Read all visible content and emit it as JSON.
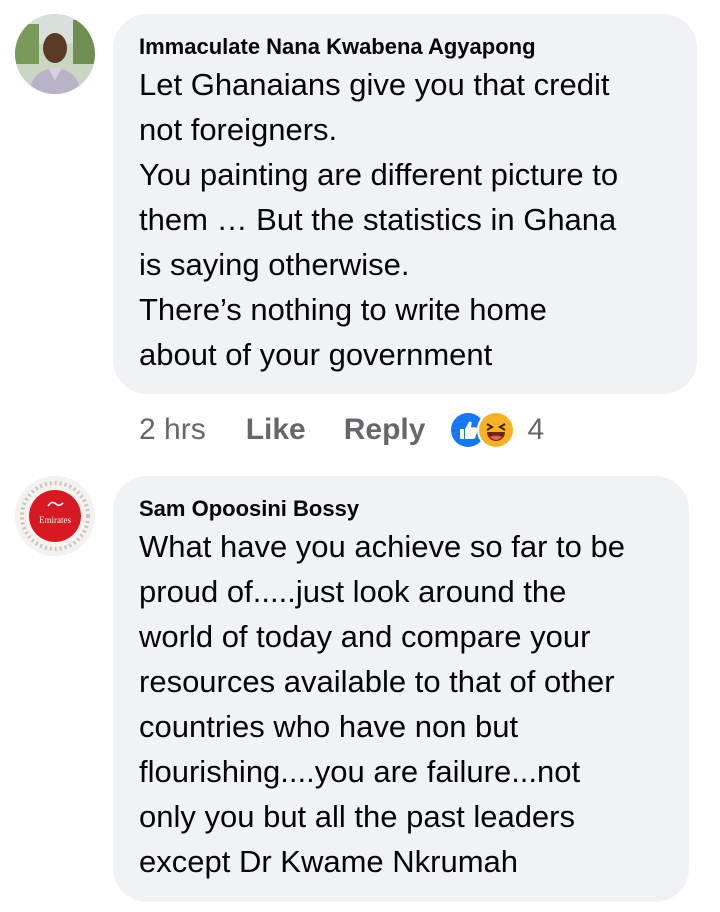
{
  "comments": [
    {
      "author": "Immaculate Nana Kwabena Agyapong",
      "avatar_icon": "user-photo-avatar",
      "text_lines": [
        "Let Ghanaians give you that credit",
        "not foreigners.",
        "You painting are different picture to",
        "them … But the statistics in Ghana",
        "is saying otherwise.",
        "There’s nothing to write home",
        "about of your government"
      ],
      "time": "2 hrs",
      "like_label": "Like",
      "reply_label": "Reply",
      "reaction_icons": [
        "like-reaction-icon",
        "haha-reaction-icon"
      ],
      "reaction_count": "4"
    },
    {
      "author": "Sam Opoosini Bossy",
      "avatar_icon": "emirates-logo-avatar",
      "avatar_logo_text": "Emirates",
      "text_lines": [
        "What have you achieve so far to be",
        "proud of.....just look around the",
        "world of today and compare your",
        "resources available to that of other",
        "countries who have non but",
        "flourishing....you are failure...not",
        "only you but all the past leaders",
        "except Dr Kwame Nkrumah"
      ]
    }
  ],
  "colors": {
    "bubble_bg": "#f0f2f5",
    "text": "#050505",
    "meta_text": "#65676b",
    "like_blue": "#1877f2",
    "haha_yellow": "#f7b125",
    "emirates_red": "#d71921"
  }
}
